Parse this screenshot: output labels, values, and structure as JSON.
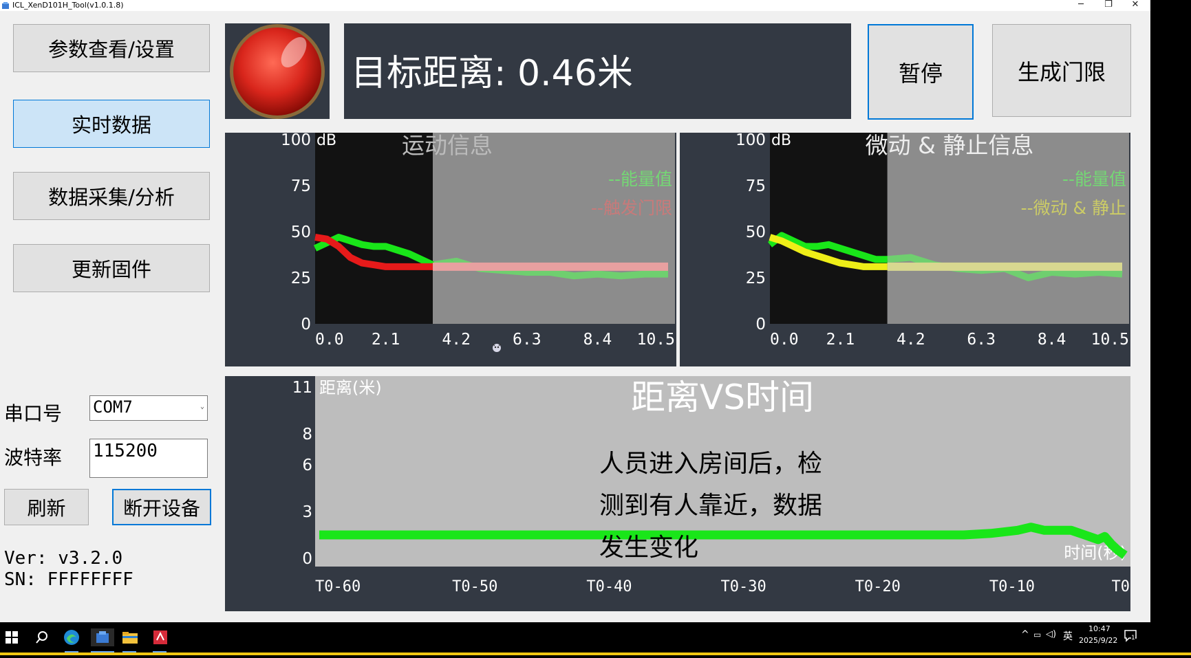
{
  "window": {
    "title": "ICL_XenD101H_Tool(v1.0.1.8)",
    "controls": {
      "minimize": "─",
      "restore": "❐",
      "close": "✕"
    }
  },
  "sidebar": {
    "buttons": [
      {
        "label": "参数查看/设置",
        "active": false
      },
      {
        "label": "实时数据",
        "active": true
      },
      {
        "label": "数据采集/分析",
        "active": false
      },
      {
        "label": "更新固件",
        "active": false
      }
    ],
    "serial_label": "串口号",
    "serial_value": "COM7",
    "baud_label": "波特率",
    "baud_value": "115200",
    "refresh_label": "刷新",
    "disconnect_label": "断开设备",
    "ver": "Ver: v3.2.0",
    "sn": "SN: FFFFFFFF"
  },
  "header": {
    "status_color": "#d9261c",
    "distance_text": "目标距离: 0.46米",
    "pause_label": "暂停",
    "gen_gate_label": "生成门限"
  },
  "chart_data": [
    {
      "type": "line",
      "title": "运动信息",
      "ylabel": "dB",
      "yticks": [
        "100",
        "75",
        "50",
        "25",
        "0"
      ],
      "xticks": [
        "0.0",
        "2.1",
        "4.2",
        "6.3",
        "8.4",
        "10.5"
      ],
      "ylim": [
        0,
        100
      ],
      "xlim": [
        0,
        10.5
      ],
      "series": [
        {
          "name": "--能量值",
          "color": "#19e619",
          "x": [
            0,
            0.35,
            0.7,
            1.05,
            1.4,
            1.75,
            2.1,
            2.45,
            2.8,
            3.15,
            3.5,
            3.85,
            4.2,
            4.9,
            5.6,
            6.3,
            7.0,
            7.7,
            8.4,
            9.1,
            9.8,
            10.5
          ],
          "y": [
            41,
            44,
            47,
            45,
            43,
            42,
            42,
            40,
            38,
            35,
            32,
            33,
            34,
            30,
            29,
            28,
            28,
            26,
            27,
            26,
            27,
            27
          ]
        },
        {
          "name": "--触发门限",
          "color": "#e61a1a",
          "x": [
            0,
            0.35,
            0.7,
            1.05,
            1.4,
            1.75,
            2.1,
            2.45,
            2.8,
            3.15,
            3.5,
            4.2,
            5.6,
            7.0,
            8.4,
            9.8,
            10.5
          ],
          "y": [
            47,
            46,
            42,
            36,
            33,
            32,
            31,
            31,
            31,
            31,
            31,
            31,
            31,
            31,
            31,
            31,
            31
          ]
        }
      ]
    },
    {
      "type": "line",
      "title": "微动 & 静止信息",
      "ylabel": "dB",
      "yticks": [
        "100",
        "75",
        "50",
        "25",
        "0"
      ],
      "xticks": [
        "0.0",
        "2.1",
        "4.2",
        "6.3",
        "8.4",
        "10.5"
      ],
      "ylim": [
        0,
        100
      ],
      "xlim": [
        0,
        10.5
      ],
      "series": [
        {
          "name": "--能量值",
          "color": "#19e619",
          "x": [
            0,
            0.35,
            0.7,
            1.05,
            1.4,
            1.75,
            2.1,
            2.45,
            2.8,
            3.15,
            3.5,
            4.2,
            4.9,
            5.6,
            6.3,
            7.0,
            7.7,
            8.4,
            9.1,
            9.8,
            10.5
          ],
          "y": [
            43,
            48,
            45,
            42,
            42,
            43,
            41,
            39,
            37,
            35,
            35,
            36,
            32,
            30,
            29,
            30,
            25,
            28,
            27,
            28,
            27
          ]
        },
        {
          "name": "--微动 & 静止",
          "color": "#eeee18",
          "x": [
            0,
            0.35,
            0.7,
            1.05,
            1.4,
            1.75,
            2.1,
            2.45,
            2.8,
            3.15,
            3.5,
            4.2,
            5.6,
            7.0,
            8.4,
            9.8,
            10.5
          ],
          "y": [
            47,
            45,
            42,
            39,
            37,
            35,
            33,
            32,
            31,
            31,
            31,
            31,
            31,
            31,
            31,
            31,
            31
          ]
        }
      ]
    },
    {
      "type": "line",
      "title": "距离VS时间",
      "ylabel": "距离(米)",
      "xlabel": "时间(秒)",
      "yticks": [
        "11",
        "8",
        "6",
        "3",
        "0"
      ],
      "ytick_values": [
        11,
        8,
        6,
        3,
        0
      ],
      "xticks": [
        "T0-60",
        "T0-50",
        "T0-40",
        "T0-30",
        "T0-20",
        "T0-10",
        "T0"
      ],
      "ylim": [
        0,
        11
      ],
      "xlim": [
        -60,
        0
      ],
      "series": [
        {
          "color": "#19e619",
          "x": [
            -60,
            -50,
            -40,
            -30,
            -20,
            -12,
            -10,
            -8,
            -7,
            -6,
            -5,
            -4,
            -3,
            -2,
            -1.5,
            -1,
            -0.5,
            0
          ],
          "y": [
            1.5,
            1.5,
            1.5,
            1.5,
            1.5,
            1.5,
            1.6,
            1.8,
            2.0,
            1.8,
            1.8,
            1.8,
            1.5,
            1.2,
            1.4,
            0.9,
            0.5,
            0.2
          ]
        }
      ]
    }
  ],
  "annotation": "人员进入房间后，检测到有人靠近，数据发生变化",
  "annotation_lines": [
    "人员进入房间后，检",
    "测到有人靠近，数据",
    "发生变化"
  ],
  "taskbar": {
    "time": "10:47",
    "date": "2025/9/22",
    "ime": "英",
    "notif_count": "1"
  }
}
